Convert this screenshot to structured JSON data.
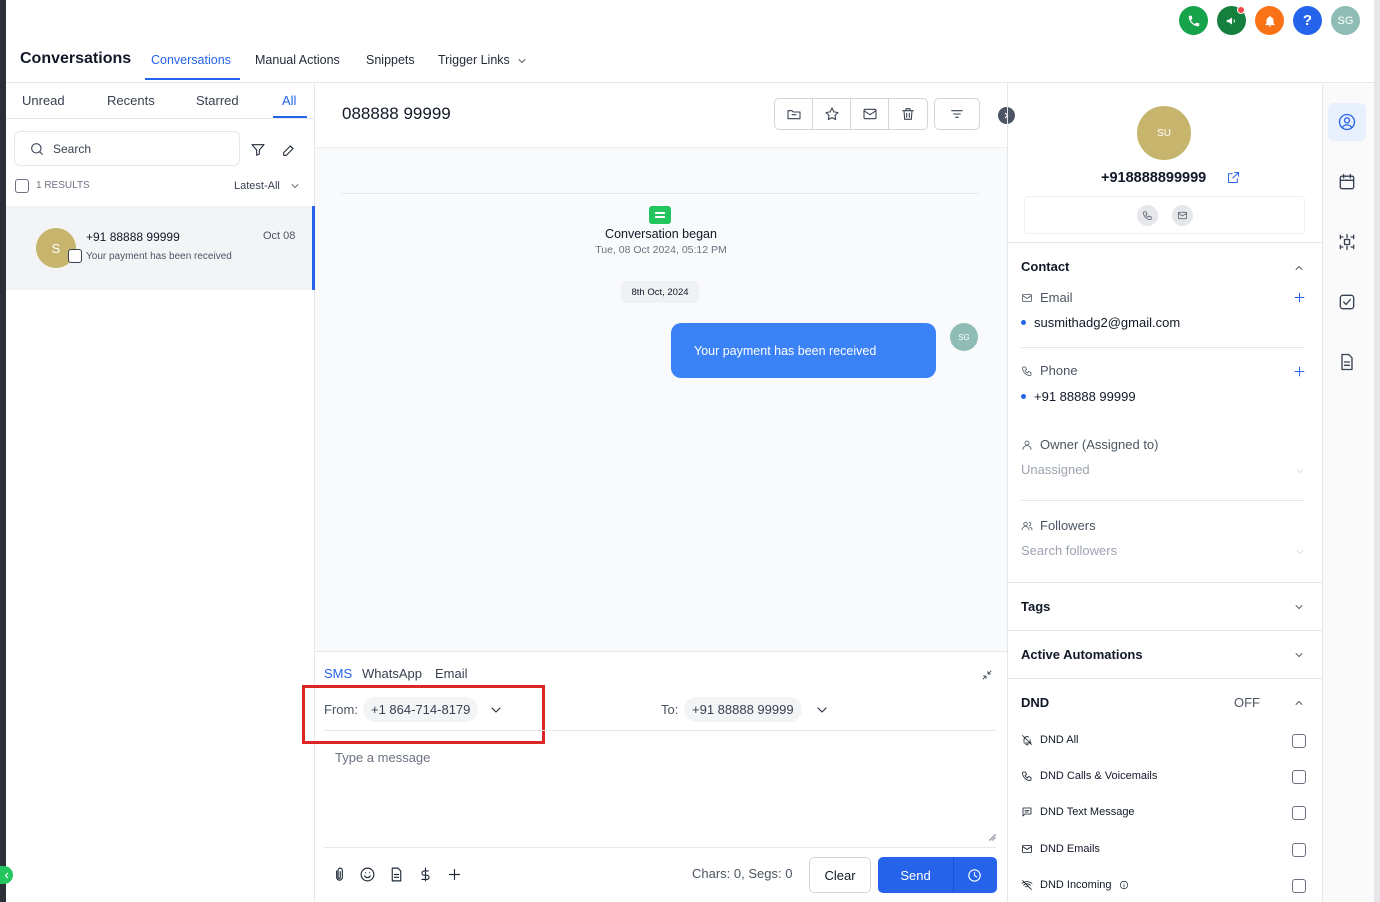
{
  "header": {
    "brand": "Conversations",
    "tabs": [
      "Conversations",
      "Manual Actions",
      "Snippets",
      "Trigger Links"
    ],
    "user_initials": "SG",
    "help_label": "?"
  },
  "list": {
    "tabs": [
      "Unread",
      "Recents",
      "Starred",
      "All"
    ],
    "search_placeholder": "Search",
    "results_label": "1 RESULTS",
    "sort_label": "Latest-All",
    "item": {
      "avatar": "S",
      "name": "+91 88888 99999",
      "date": "Oct 08",
      "preview": "Your payment has been received"
    }
  },
  "conversation": {
    "title": "088888 99999",
    "began_label": "Conversation began",
    "began_time": "Tue, 08 Oct 2024, 05:12 PM",
    "date_chip": "8th Oct, 2024",
    "message": "Your payment has been received",
    "sender_initials": "SG"
  },
  "composer": {
    "tabs": [
      "SMS",
      "WhatsApp",
      "Email"
    ],
    "from_label": "From:",
    "from_value": "+1 864-714-8179",
    "to_label": "To:",
    "to_value": "+91 88888 99999",
    "placeholder": "Type a message",
    "counter": "Chars: 0, Segs: 0",
    "clear_label": "Clear",
    "send_label": "Send"
  },
  "contact": {
    "avatar": "SU",
    "phone_title": "+918888899999",
    "contact_heading": "Contact",
    "email_label": "Email",
    "email_value": "susmithadg2@gmail.com",
    "phone_label": "Phone",
    "phone_value": "+91 88888 99999",
    "owner_label": "Owner (Assigned to)",
    "owner_value": "Unassigned",
    "followers_label": "Followers",
    "followers_placeholder": "Search followers",
    "tags_heading": "Tags",
    "automations_heading": "Active Automations",
    "dnd_heading": "DND",
    "dnd_state": "OFF",
    "dnd_items": [
      "DND All",
      "DND Calls & Voicemails",
      "DND Text Message",
      "DND Emails",
      "DND Incoming"
    ]
  },
  "colors": {
    "accent": "#2563eb",
    "bubble": "#3b82f6",
    "highlight": "#dc2626",
    "avatar": "#c7b56d"
  }
}
